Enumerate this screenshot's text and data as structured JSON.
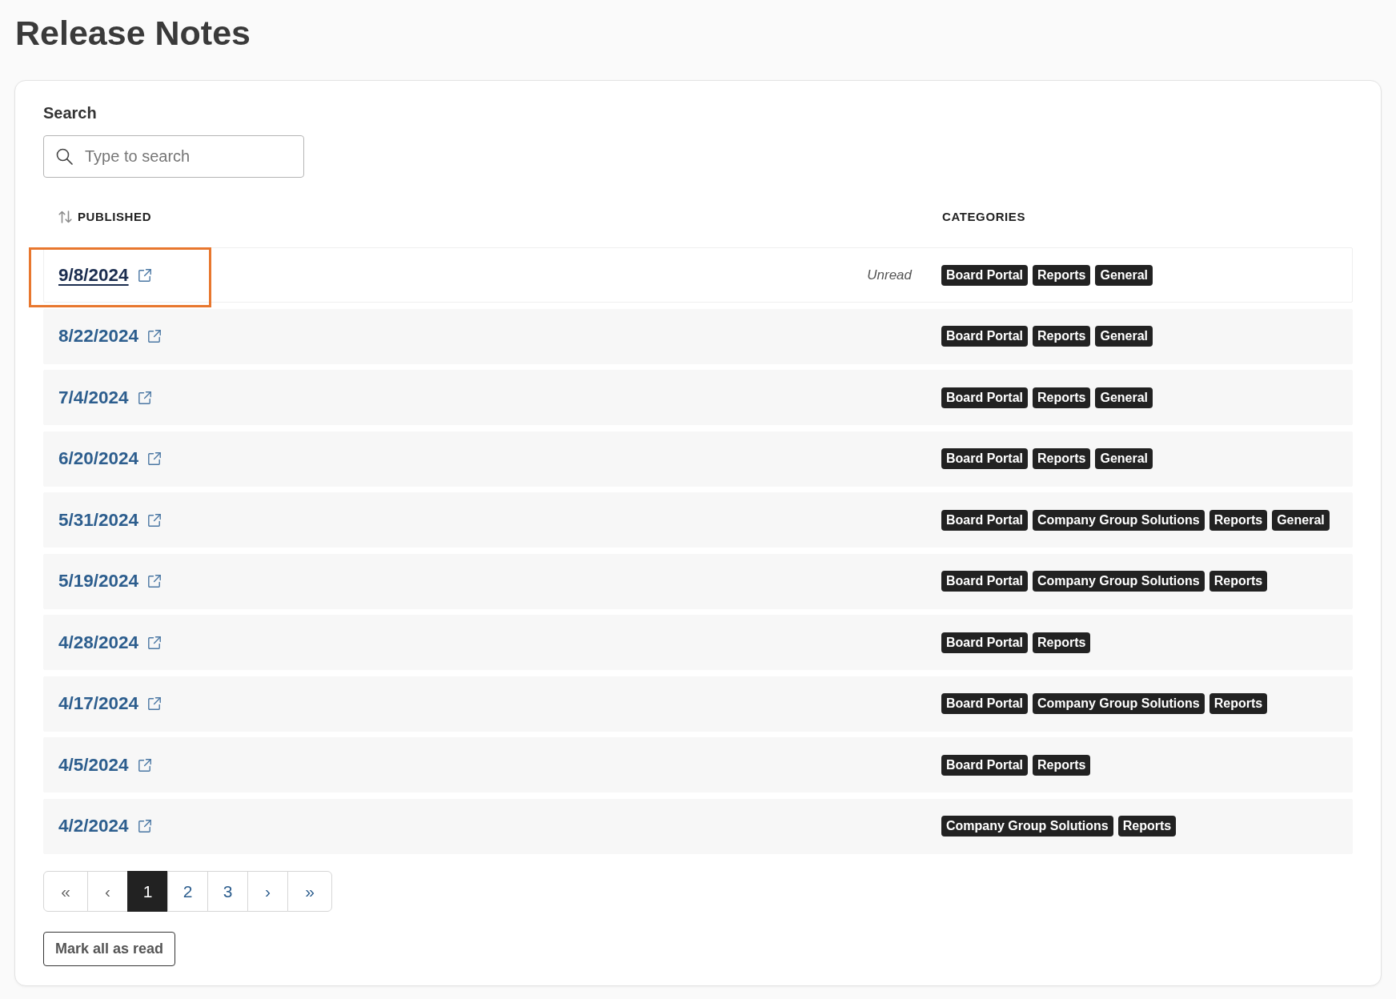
{
  "page": {
    "title": "Release Notes"
  },
  "search": {
    "label": "Search",
    "placeholder": "Type to search"
  },
  "table": {
    "columns": [
      {
        "label": "PUBLISHED",
        "sortable": true
      },
      {
        "label": "CATEGORIES",
        "sortable": false
      }
    ],
    "rows": [
      {
        "published": "9/8/2024",
        "status": "Unread",
        "unread": true,
        "focused": true,
        "categories": [
          "Board Portal",
          "Reports",
          "General"
        ]
      },
      {
        "published": "8/22/2024",
        "unread": false,
        "focused": false,
        "categories": [
          "Board Portal",
          "Reports",
          "General"
        ]
      },
      {
        "published": "7/4/2024",
        "unread": false,
        "focused": false,
        "categories": [
          "Board Portal",
          "Reports",
          "General"
        ]
      },
      {
        "published": "6/20/2024",
        "unread": false,
        "focused": false,
        "categories": [
          "Board Portal",
          "Reports",
          "General"
        ]
      },
      {
        "published": "5/31/2024",
        "unread": false,
        "focused": false,
        "categories": [
          "Board Portal",
          "Company Group Solutions",
          "Reports",
          "General"
        ]
      },
      {
        "published": "5/19/2024",
        "unread": false,
        "focused": false,
        "categories": [
          "Board Portal",
          "Company Group Solutions",
          "Reports"
        ]
      },
      {
        "published": "4/28/2024",
        "unread": false,
        "focused": false,
        "categories": [
          "Board Portal",
          "Reports"
        ]
      },
      {
        "published": "4/17/2024",
        "unread": false,
        "focused": false,
        "categories": [
          "Board Portal",
          "Company Group Solutions",
          "Reports"
        ]
      },
      {
        "published": "4/5/2024",
        "unread": false,
        "focused": false,
        "categories": [
          "Board Portal",
          "Reports"
        ]
      },
      {
        "published": "4/2/2024",
        "unread": false,
        "focused": false,
        "categories": [
          "Company Group Solutions",
          "Reports"
        ]
      }
    ]
  },
  "pagination": [
    {
      "label": "«",
      "selected": false,
      "disabled": true
    },
    {
      "label": "‹",
      "selected": false,
      "disabled": true
    },
    {
      "label": "1",
      "selected": true,
      "disabled": false
    },
    {
      "label": "2",
      "selected": false,
      "disabled": false
    },
    {
      "label": "3",
      "selected": false,
      "disabled": false
    },
    {
      "label": "›",
      "selected": false,
      "disabled": false
    },
    {
      "label": "»",
      "selected": false,
      "disabled": false
    }
  ],
  "mark_all_button": "Mark all as read"
}
